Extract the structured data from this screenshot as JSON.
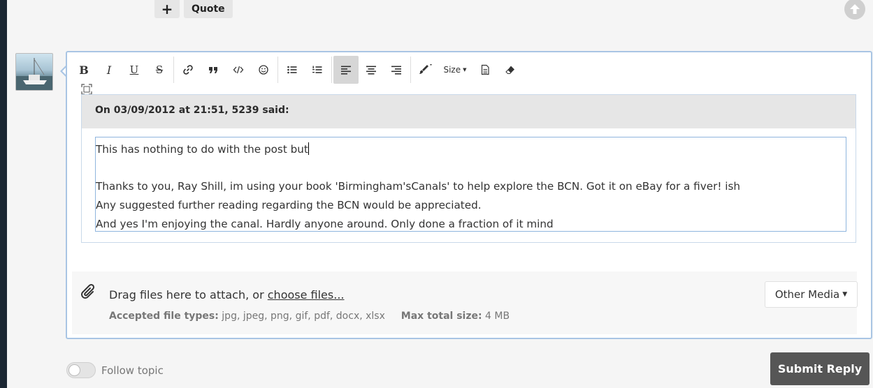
{
  "top_actions": {
    "plus_label": "+",
    "quote_label": "Quote"
  },
  "toolbar": {
    "bold": "B",
    "italic": "I",
    "underline": "U",
    "strike": "S",
    "link_icon": "link-icon",
    "quote_icon": "blockquote-icon",
    "code_icon": "code-icon",
    "emoji_icon": "emoji-icon",
    "bullet_list_icon": "bullet-list-icon",
    "numbered_list_icon": "numbered-list-icon",
    "align_left_icon": "align-left-icon",
    "align_center_icon": "align-center-icon",
    "align_right_icon": "align-right-icon",
    "color_icon": "paintbrush-icon",
    "size_label": "Size",
    "source_icon": "document-icon",
    "clear_icon": "eraser-icon"
  },
  "quote": {
    "header": "On 03/09/2012 at 21:51, 5239 said:",
    "lines": [
      "This has nothing to do with the post but",
      "",
      "Thanks to you, Ray Shill, im using your book 'Birmingham'sCanals' to help explore the BCN. Got it on eBay for a fiver! ish",
      "Any suggested further reading regarding the BCN would be appreciated.",
      "And yes I'm enjoying the canal. Hardly anyone around. Only done a fraction of it mind"
    ]
  },
  "attachments": {
    "drag_text": "Drag files here to attach, or ",
    "choose_link": "choose files...",
    "accepted_label": "Accepted file types:",
    "accepted_value": "jpg, jpeg, png, gif, pdf, docx, xlsx",
    "max_label": "Max total size:",
    "max_value": "4 MB",
    "other_media_label": "Other Media"
  },
  "footer": {
    "follow_label": "Follow topic",
    "submit_label": "Submit Reply"
  },
  "colors": {
    "editor_border": "#a9c5e4",
    "submit_bg": "#565656",
    "left_strip": "#1b2733"
  }
}
